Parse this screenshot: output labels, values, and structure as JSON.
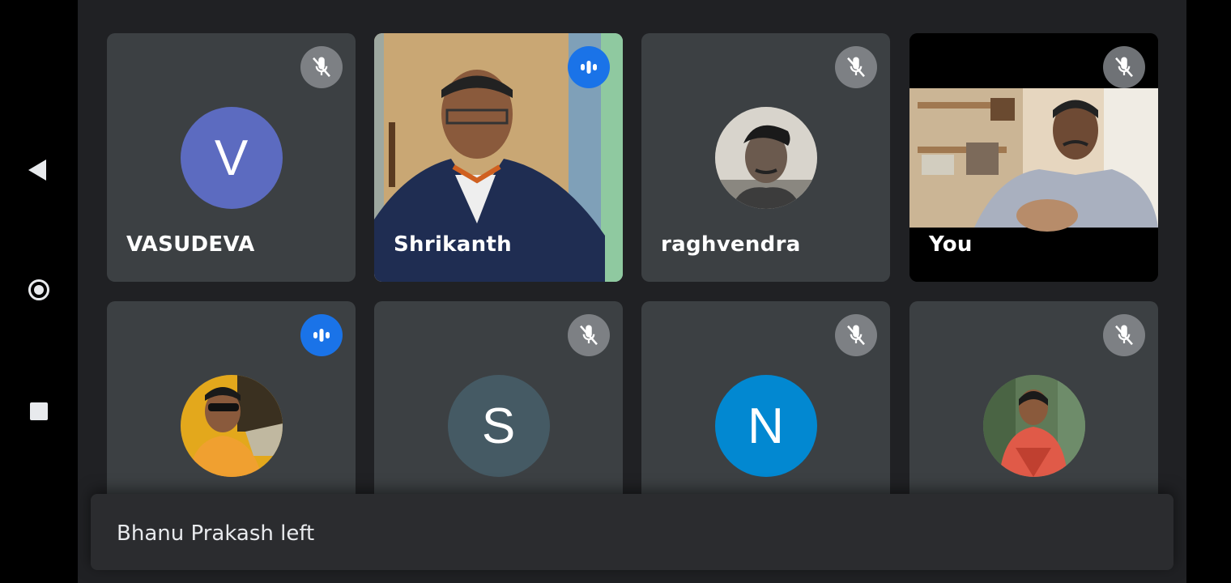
{
  "system_nav": {
    "back_icon": "back-triangle-icon",
    "home_icon": "home-circle-icon",
    "recents_icon": "recents-square-icon"
  },
  "participants": [
    {
      "name": "VASUDEVA",
      "initial": "V",
      "avatar_color": "#5c6bc0",
      "mic": "muted"
    },
    {
      "name": "Shrikanth",
      "mic": "speaking"
    },
    {
      "name": "raghvendra",
      "mic": "muted"
    },
    {
      "name": "You",
      "mic": "muted"
    },
    {
      "name": "",
      "mic": "speaking"
    },
    {
      "name": "",
      "initial": "S",
      "avatar_color": "#455a64",
      "mic": "muted"
    },
    {
      "name": "",
      "initial": "N",
      "avatar_color": "#0288d1",
      "mic": "muted"
    },
    {
      "name": "",
      "mic": "muted"
    }
  ],
  "notification": {
    "text": "Bhanu Prakash left"
  },
  "colors": {
    "background": "#202124",
    "tile": "#3c4043",
    "speaking_blue": "#1a73e8",
    "muted_gray": "#7d8084"
  }
}
